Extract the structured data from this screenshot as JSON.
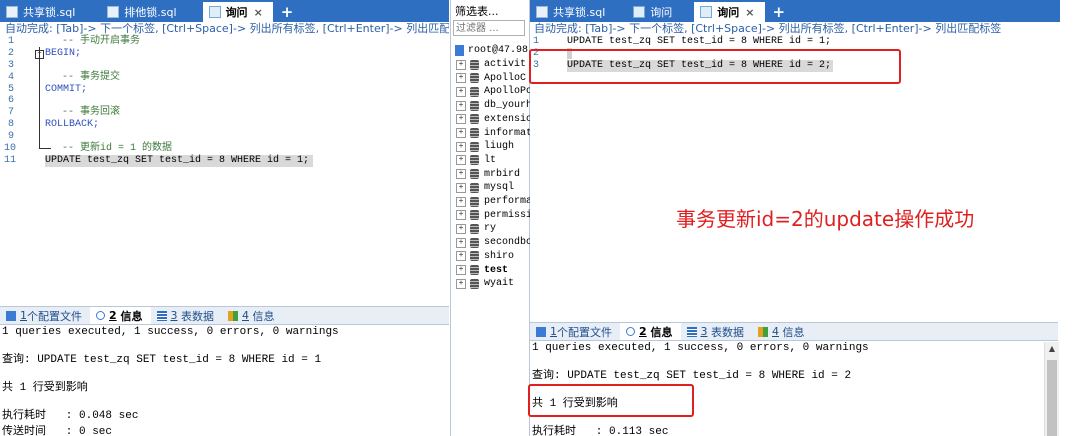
{
  "left": {
    "tabs": [
      {
        "label": "共享锁.sql",
        "icon": "sql-file-icon"
      },
      {
        "label": "排他锁.sql",
        "icon": "sql-file-icon"
      },
      {
        "label": "询问",
        "icon": "query-icon",
        "close": "×"
      }
    ],
    "plus": "+",
    "hint": "自动完成: [Tab]-> 下一个标签, [Ctrl+Space]-> 列出所有标签, [Ctrl+Enter]-> 列出匹配标签",
    "code": [
      {
        "n": "1",
        "t": "-- 手动开启事务"
      },
      {
        "n": "2",
        "t": "BEGIN;"
      },
      {
        "n": "3",
        "t": ""
      },
      {
        "n": "4",
        "t": "-- 事务提交"
      },
      {
        "n": "5",
        "t": "COMMIT;"
      },
      {
        "n": "6",
        "t": ""
      },
      {
        "n": "7",
        "t": "-- 事务回滚"
      },
      {
        "n": "8",
        "t": "ROLLBACK;"
      },
      {
        "n": "9",
        "t": ""
      },
      {
        "n": "10",
        "t": "-- 更新id = 1 的数据"
      },
      {
        "n": "11",
        "t": "UPDATE test_zq SET test_id = 8 WHERE id = 1;"
      }
    ],
    "bottom_tabs": [
      {
        "num": "1",
        "label": "个配置文件"
      },
      {
        "num": "2",
        "label": "信息"
      },
      {
        "num": "3",
        "label": "表数据"
      },
      {
        "num": "4",
        "label": "信息"
      }
    ],
    "info": {
      "summary": "1 queries executed, 1 success, 0 errors, 0 warnings",
      "query": "查询: UPDATE test_zq SET test_id = 8 WHERE id = 1",
      "affected": "共 1 行受到影响",
      "exec_time": "执行耗时   : 0.048 sec",
      "transfer_time": "传送时间   : 0 sec"
    }
  },
  "filter": {
    "title": "筛选表...",
    "placeholder": "过滤器 ...",
    "root": "root@47.98",
    "databases": [
      "activit",
      "ApolloC",
      "ApolloPo",
      "db_yourh",
      "extensio",
      "informat",
      "liugh",
      "lt",
      "mrbird",
      "mysql",
      "performa",
      "permissi",
      "ry",
      "secondbo",
      "shiro",
      "test",
      "wyait"
    ],
    "bold_db": "test"
  },
  "right": {
    "tabs": [
      {
        "label": "共享锁.sql",
        "icon": "sql-file-icon"
      },
      {
        "label": "询问",
        "icon": "query-icon"
      },
      {
        "label": "询问",
        "icon": "query-icon",
        "close": "×"
      }
    ],
    "plus": "+",
    "hint": "自动完成: [Tab]-> 下一个标签, [Ctrl+Space]-> 列出所有标签, [Ctrl+Enter]-> 列出匹配标签",
    "code": [
      {
        "n": "1",
        "t": "UPDATE test_zq SET test_id = 8 WHERE id = 1;"
      },
      {
        "n": "2",
        "t": ""
      },
      {
        "n": "3",
        "t": "UPDATE test_zq SET test_id = 8 WHERE id = 2;"
      }
    ],
    "bottom_tabs": [
      {
        "num": "1",
        "label": "个配置文件"
      },
      {
        "num": "2",
        "label": "信息"
      },
      {
        "num": "3",
        "label": "表数据"
      },
      {
        "num": "4",
        "label": "信息"
      }
    ],
    "info": {
      "summary": "1 queries executed, 1 success, 0 errors, 0 warnings",
      "query": "查询: UPDATE test_zq SET test_id = 8 WHERE id = 2",
      "affected": "共 1 行受到影响",
      "exec_time": "执行耗时   : 0.113 sec"
    }
  },
  "annotation": "事务更新id=2的update操作成功",
  "colors": {
    "accent": "#2f6fc2",
    "annotation": "#e02020",
    "comment": "#3d7a3d",
    "keyword": "#2f4fc0"
  }
}
